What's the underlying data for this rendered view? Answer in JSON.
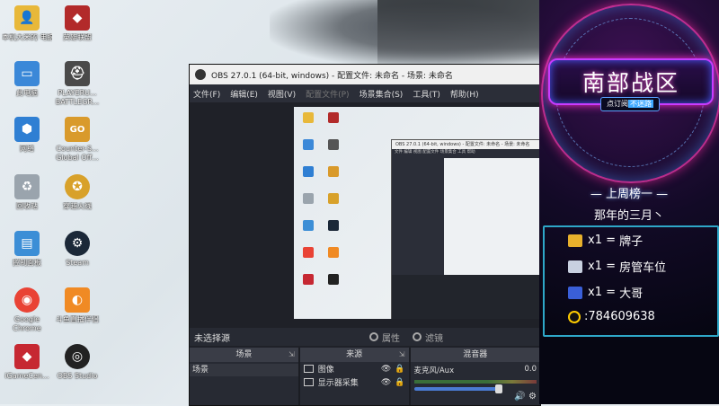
{
  "desktop_icons": [
    {
      "label": "本机大米的\n电脑",
      "color": "#e8b83a",
      "glyph": "👤"
    },
    {
      "label": "此电脑",
      "color": "#3b88d8",
      "glyph": "🖥"
    },
    {
      "label": "网络",
      "color": "#2f7fd3",
      "glyph": "⬢"
    },
    {
      "label": "回收站",
      "color": "#9aa4ad",
      "glyph": "🗑"
    },
    {
      "label": "控制面板",
      "color": "#3c8ed6",
      "glyph": "▤"
    },
    {
      "label": "Google\nChrome",
      "color": "#e94335",
      "glyph": "◉"
    },
    {
      "label": "iGameCen...",
      "color": "#c62832",
      "glyph": "◆"
    },
    {
      "label": "英雄联盟",
      "color": "#b22a2a",
      "glyph": "◆"
    },
    {
      "label": "PLAYERU...\nBATTLEGR...",
      "color": "#4a4a4a",
      "glyph": "⛑"
    },
    {
      "label": "Counter-S...\nGlobal Off...",
      "color": "#d99a2b",
      "glyph": "GO"
    },
    {
      "label": "穿越火线",
      "color": "#d8a12a",
      "glyph": "✪"
    },
    {
      "label": "Steam",
      "color": "#1b2838",
      "glyph": "⚙"
    },
    {
      "label": "斗鱼直播伴侣",
      "color": "#f08a24",
      "glyph": "◐"
    },
    {
      "label": "OBS Studio",
      "color": "#222",
      "glyph": "◎"
    }
  ],
  "obs": {
    "title": "OBS 27.0.1 (64-bit, windows) - 配置文件: 未命名 - 场景: 未命名",
    "menu": [
      "文件(F)",
      "编辑(E)",
      "视图(V)",
      "配置文件(P)",
      "场景集合(S)",
      "工具(T)",
      "帮助(H)"
    ],
    "nested_title": "OBS 27.0.1 (64-bit, windows) - 配置文件: 未命名 - 场景: 未命名",
    "no_source": "未选择源",
    "properties": "属性",
    "filters": "滤镜",
    "scenes_header": "场景",
    "sources_header": "来源",
    "mixer_header": "混音器",
    "scene_item": "场景",
    "sources": [
      {
        "name": "图像"
      },
      {
        "name": "显示器采集"
      }
    ],
    "mixer_channel": "麦克风/Aux",
    "mixer_db": "0.0"
  },
  "overlay": {
    "title": "南部战区",
    "sub_prefix": "点订阅",
    "sub_highlight": "不迷路",
    "weekly_label": "上周榜一",
    "top_user": "那年的三月丶",
    "ranks": [
      {
        "qty": "x1",
        "eq": "=",
        "name": "牌子",
        "color": "#e8b02c"
      },
      {
        "qty": "x1",
        "eq": "=",
        "name": "房管车位",
        "color": "#c8d0e0"
      },
      {
        "qty": "x1",
        "eq": "=",
        "name": "大哥",
        "color": "#3a5fd8"
      }
    ],
    "qq": ":784609638"
  }
}
